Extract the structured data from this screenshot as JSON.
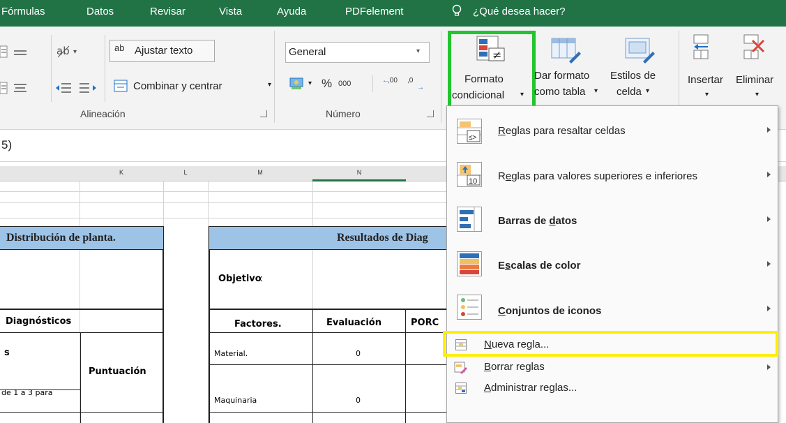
{
  "tabs": [
    "Fórmulas",
    "Datos",
    "Revisar",
    "Vista",
    "Ayuda",
    "PDFelement"
  ],
  "tell_me": "¿Qué desea hacer?",
  "ribbon": {
    "wrap_text": "Ajustar texto",
    "merge_center": "Combinar y centrar",
    "alignment_group": "Alineación",
    "number_format": "General",
    "percent": "%",
    "thousands": "000",
    "inc_decimal": ",00",
    "dec_decimal": ",0",
    "number_group": "Número",
    "cond_format_l1": "Formato",
    "cond_format_l2": "condicional",
    "format_table_l1": "Dar formato",
    "format_table_l2": "como tabla",
    "cell_styles_l1": "Estilos de",
    "cell_styles_l2": "celda",
    "insert": "Insertar",
    "delete": "Eliminar"
  },
  "formula_bar": "5)",
  "columns": [
    "K",
    "L",
    "M",
    "N"
  ],
  "sheet": {
    "left_header": "Distribución de planta.",
    "right_header": "Resultados de Diag",
    "objetivo": "Objetivo",
    "diagnosticos": "Diagnósticos",
    "factores": "Factores.",
    "evaluacion": "Evaluación",
    "porc": "PORC",
    "s": "s",
    "puntuacion": "Puntuación",
    "material": "Material.",
    "material_val": "0",
    "de1a3": "de 1 a 3 para",
    "maquinaria": "Maquinaria",
    "maquinaria_val": "0"
  },
  "menu": [
    {
      "label": "Reglas para resaltar celdas",
      "key": "R",
      "rest": "eglas para resaltar celdas",
      "icon": "highlight-cells-rules-icon",
      "submenu": true
    },
    {
      "label": "Reglas para valores superiores e inferiores",
      "key": "e",
      "pre": "R",
      "rest": "glas para valores superiores e inferiores",
      "icon": "top-bottom-rules-icon",
      "submenu": true
    },
    {
      "label": "Barras de datos",
      "pre": "Barras de ",
      "key": "d",
      "rest": "atos",
      "icon": "data-bars-icon",
      "submenu": true
    },
    {
      "label": "Escalas de color",
      "pre": "E",
      "key": "s",
      "rest": "calas de color",
      "icon": "color-scales-icon",
      "submenu": true
    },
    {
      "label": "Conjuntos de iconos",
      "pre": "",
      "key": "C",
      "rest": "onjuntos de iconos",
      "icon": "icon-sets-icon",
      "submenu": true
    },
    {
      "label": "Nueva regla...",
      "key": "N",
      "rest": "ueva regla...",
      "icon": "new-rule-icon",
      "submenu": false
    },
    {
      "label": "Borrar reglas",
      "key": "B",
      "rest": "orrar reglas",
      "icon": "clear-rules-icon",
      "submenu": true
    },
    {
      "label": "Administrar reglas...",
      "key": "A",
      "rest": "dministrar reglas...",
      "icon": "manage-rules-icon",
      "submenu": false
    }
  ],
  "colors": {
    "excel_green": "#217346",
    "highlight_green": "#22c52e",
    "highlight_yellow": "#ffee00",
    "header_blue": "#9dc3e6"
  }
}
